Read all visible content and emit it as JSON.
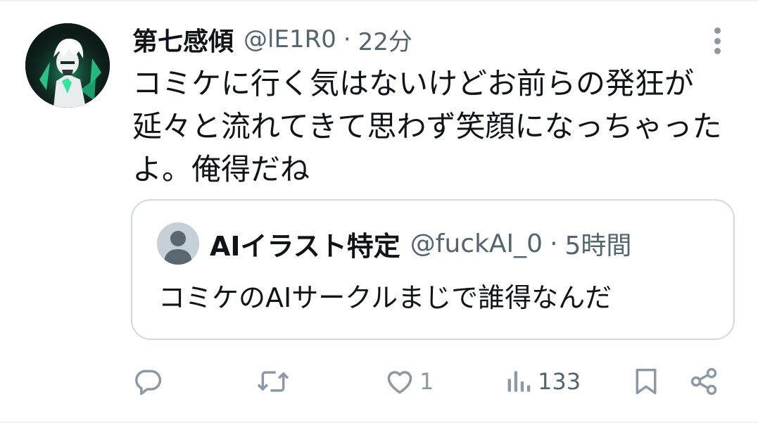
{
  "tweet": {
    "display_name": "第七感傾",
    "handle": "@lE1R0",
    "separator": "·",
    "time": "22分",
    "text": "コミケに行く気はないけどお前らの発狂が延々と流れてきて思わず笑顔になっちゃったよ。俺得だね",
    "avatar_icon": "anime-character-avatar"
  },
  "quote": {
    "display_name": "AIイラスト特定",
    "handle": "@fuckAI_0",
    "separator": "·",
    "time": "5時間",
    "text": "コミケのAIサークルまじで誰得なんだ",
    "avatar_icon": "default-user-avatar"
  },
  "actions": {
    "reply_icon": "reply-icon",
    "retweet_icon": "retweet-icon",
    "like_icon": "heart-icon",
    "like_count": "1",
    "views_icon": "views-icon",
    "views_count": "133",
    "bookmark_icon": "bookmark-icon",
    "share_icon": "share-icon"
  },
  "colors": {
    "text_primary": "#0f1419",
    "text_secondary": "#536471",
    "icon_gray": "#8b98a5",
    "border": "#cfd9de",
    "avatar_accent": "#2ee6a0"
  }
}
